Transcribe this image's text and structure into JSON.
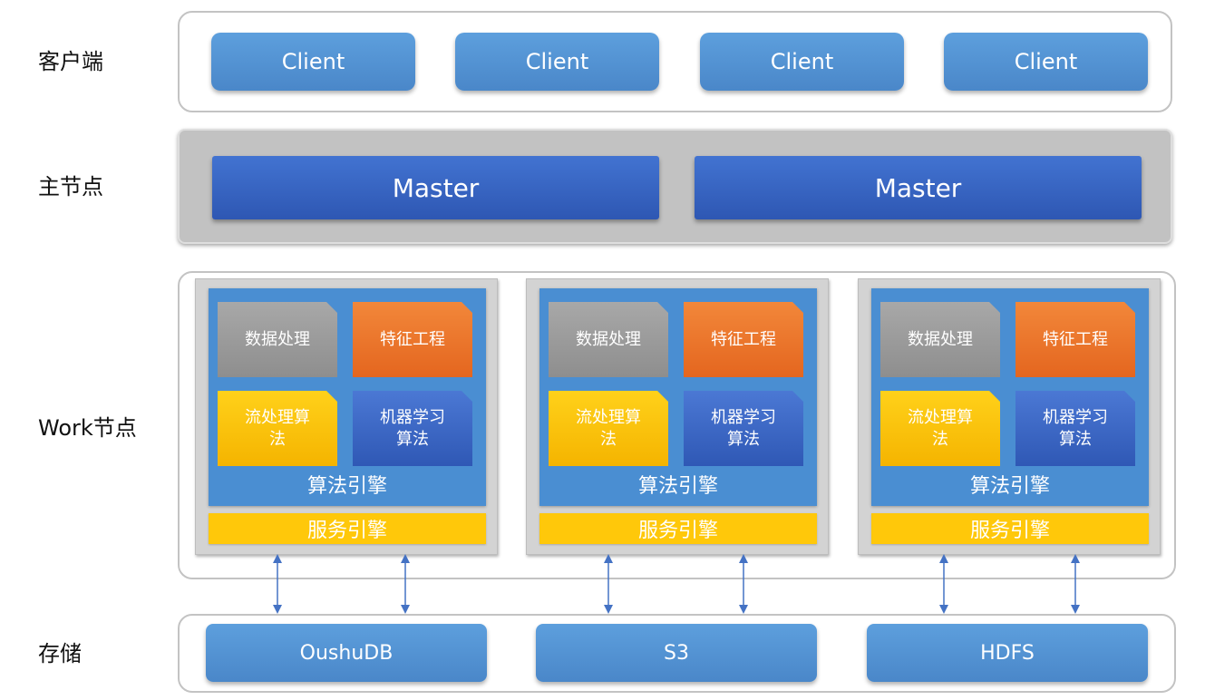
{
  "labels": {
    "client_tier": "客户端",
    "master_tier": "主节点",
    "worker_tier": "Work节点",
    "storage_tier": "存储"
  },
  "clients": [
    "Client",
    "Client",
    "Client",
    "Client"
  ],
  "masters": [
    "Master",
    "Master"
  ],
  "workers": [
    {
      "modules": {
        "data_processing": "数据处理",
        "feature_engineering": "特征工程",
        "stream_algorithm": "流处理算法",
        "ml_algorithm": "机器学习算法"
      },
      "algorithm_engine": "算法引擎",
      "service_engine": "服务引擎"
    },
    {
      "modules": {
        "data_processing": "数据处理",
        "feature_engineering": "特征工程",
        "stream_algorithm": "流处理算法",
        "ml_algorithm": "机器学习算法"
      },
      "algorithm_engine": "算法引擎",
      "service_engine": "服务引擎"
    },
    {
      "modules": {
        "data_processing": "数据处理",
        "feature_engineering": "特征工程",
        "stream_algorithm": "流处理算法",
        "ml_algorithm": "机器学习算法"
      },
      "algorithm_engine": "算法引擎",
      "service_engine": "服务引擎"
    }
  ],
  "storage": [
    "OushuDB",
    "S3",
    "HDFS"
  ],
  "colors": {
    "client_blue": "#5296d8",
    "master_blue": "#3561c1",
    "master_band": "#c2c2c2",
    "data_gray": "#9b9b9b",
    "feature_orange": "#ec7a2c",
    "stream_yellow": "#fcc40c",
    "ml_blue": "#3c68c4",
    "engine_blue": "#4a8ed2",
    "service_yellow": "#ffc80a",
    "arrow_blue": "#4472c4"
  }
}
